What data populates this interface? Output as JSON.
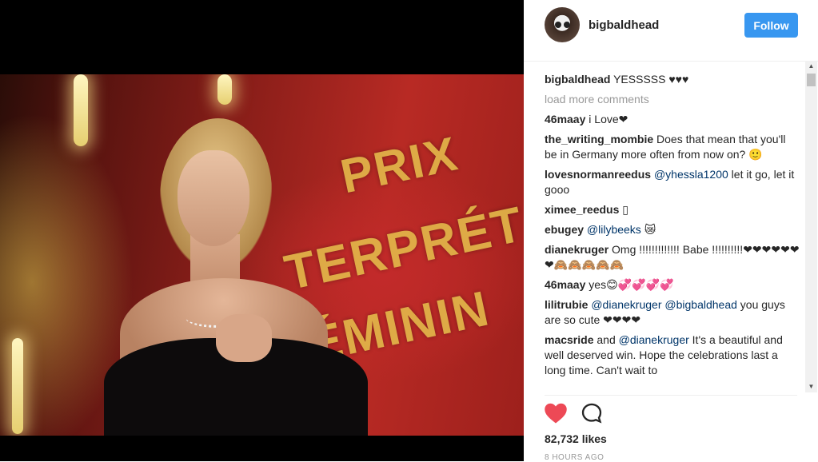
{
  "post": {
    "username": "bigbaldhead",
    "follow_label": "Follow",
    "likes": "82,732 likes",
    "time": "8 HOURS AGO"
  },
  "photo": {
    "banner_line1": "PRIX",
    "banner_line2": "TERPRÉT",
    "banner_line3": "ÉMININ"
  },
  "comments": {
    "caption_user": "bigbaldhead",
    "caption_text": "YESSSSS ♥♥♥",
    "load_more": "load more comments",
    "items": [
      {
        "user": "46maay",
        "text": "i Love❤"
      },
      {
        "user": "the_writing_mombie",
        "text": "Does that mean that you'll be in Germany more often from now on? 🙂"
      },
      {
        "user": "lovesnormanreedus",
        "mention": "@yhessla1200",
        "text": "let it go, let it gooo"
      },
      {
        "user": "ximee_reedus",
        "text": "▯"
      },
      {
        "user": "ebugey",
        "mention": "@lilybeeks",
        "text": "😿"
      },
      {
        "user": "dianekruger",
        "text": "Omg !!!!!!!!!!!!! Babe !!!!!!!!!!❤❤❤❤❤❤❤🙈🙈🙈🙈🙈"
      },
      {
        "user": "46maay",
        "text": "yes😊💞💞💞💞"
      },
      {
        "user": "lilitrubie",
        "mention": "@dianekruger",
        "mention2": "@bigbaldhead",
        "text": "you guys are so cute ❤❤❤❤"
      },
      {
        "user": "macsride",
        "pre": "and",
        "mention": "@dianekruger",
        "text": "It's a beautiful and well deserved win. Hope the celebrations last a long time. Can't wait to"
      }
    ]
  },
  "icons": {
    "like": "heart-icon",
    "comment": "comment-bubble-icon",
    "scroll_up": "▲",
    "scroll_down": "▼"
  },
  "colors": {
    "follow_bg": "#3897f0",
    "like_heart": "#ed4956",
    "mention": "#003569"
  }
}
